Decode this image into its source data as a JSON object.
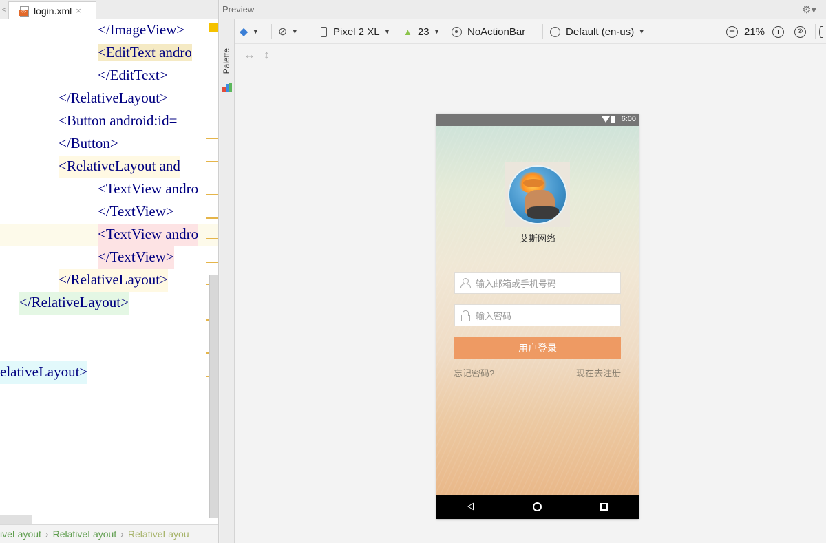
{
  "editor": {
    "tab_label": "login.xml",
    "tab_close": "×",
    "tab_scroll": "<",
    "lines": [
      {
        "indent": 142,
        "text": "</ImageView>"
      },
      {
        "indent": 142,
        "text": "<EditText andro"
      },
      {
        "indent": 142,
        "text": "</EditText>"
      },
      {
        "indent": 85,
        "text": "</RelativeLayout>"
      },
      {
        "indent": 85,
        "text": "<Button android:id="
      },
      {
        "indent": 85,
        "text": "</Button>"
      },
      {
        "indent": 85,
        "text": "<RelativeLayout and"
      },
      {
        "indent": 142,
        "text": "<TextView andro"
      },
      {
        "indent": 142,
        "text": "</TextView>"
      },
      {
        "indent": 142,
        "text": "<TextView andro"
      },
      {
        "indent": 142,
        "text": "</TextView>"
      },
      {
        "indent": 85,
        "text": "</RelativeLayout>"
      },
      {
        "indent": 28,
        "text": "</RelativeLayout>"
      },
      {
        "indent": 0,
        "text": ""
      },
      {
        "indent": 0,
        "text": "elativeLayout>"
      }
    ],
    "breadcrumb": [
      "iveLayout",
      "RelativeLayout",
      "RelativeLayou"
    ],
    "breadcrumb_sep": "›"
  },
  "preview": {
    "title": "Preview",
    "palette_label": "Palette",
    "toolbar": {
      "device": "Pixel 2 XL",
      "api_level": "23",
      "theme": "NoActionBar",
      "locale": "Default (en-us)",
      "zoom": "21%"
    }
  },
  "phone": {
    "status_time": "6:00",
    "app_name": "艾斯网络",
    "email_placeholder": "输入邮箱或手机号码",
    "password_placeholder": "输入密码",
    "login_button": "用户登录",
    "forgot_password": "忘记密码?",
    "register": "现在去注册"
  },
  "colors": {
    "accent_button": "#ee9a63",
    "xml_tag": "#000080",
    "xml_attr": "#660e7a"
  }
}
